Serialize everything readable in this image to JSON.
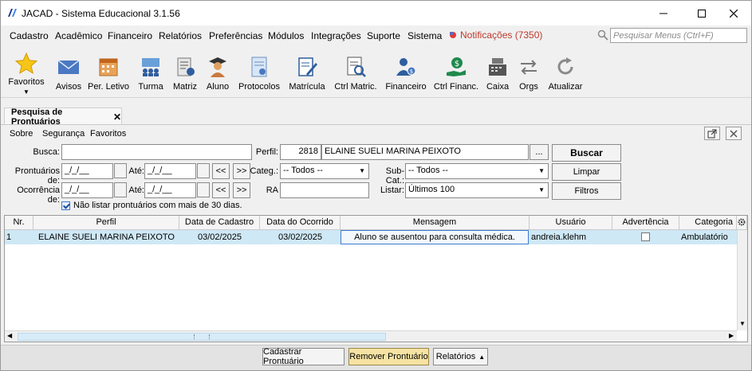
{
  "window": {
    "title": "JACAD - Sistema Educacional 3.1.56"
  },
  "menu": {
    "items": [
      "Cadastro",
      "Acadêmico",
      "Financeiro",
      "Relatórios",
      "Preferências",
      "Módulos",
      "Integrações",
      "Suporte",
      "Sistema"
    ],
    "notifications": "Notificações (7350)",
    "search_placeholder": "Pesquisar Menus (Ctrl+F)"
  },
  "toolbar": {
    "items": [
      "Favoritos",
      "Avisos",
      "Per. Letivo",
      "Turma",
      "Matriz",
      "Aluno",
      "Protocolos",
      "Matrícula",
      "Ctrl Matric.",
      "Financeiro",
      "Ctrl Financ.",
      "Caixa",
      "Orgs",
      "Atualizar"
    ]
  },
  "tab": {
    "label": "Pesquisa de Prontuários"
  },
  "submenu": {
    "items": [
      "Sobre",
      "Segurança",
      "Favoritos"
    ]
  },
  "form": {
    "busca_label": "Busca:",
    "busca_value": "",
    "perfil_label": "Perfil:",
    "perfil_code": "2818",
    "perfil_name": "ELAINE SUELI MARINA PEIXOTO",
    "perfil_btn": "...",
    "prontuarios_label": "Prontuários de:",
    "ocorrencia_label": "Ocorrência de:",
    "ate_label": "Até:",
    "date_empty": "_/_/__",
    "prev_btn": "<<",
    "next_btn": ">>",
    "categ_label": "Categ.:",
    "categ_value": "-- Todos --",
    "subcat_label": "Sub-Cat.:",
    "subcat_value": "-- Todos --",
    "ra_label": "RA",
    "ra_value": "",
    "listar_label": "Listar:",
    "listar_value": "Últimos 100",
    "buscar": "Buscar",
    "limpar": "Limpar",
    "filtros": "Filtros",
    "checkbox_label": "Não listar prontuários com mais de 30 dias.",
    "checkbox_checked": true
  },
  "grid": {
    "headers": [
      "Nr.",
      "Perfil",
      "Data de Cadastro",
      "Data do Ocorrido",
      "Mensagem",
      "Usuário",
      "Advertência",
      "Categoria"
    ],
    "rows": [
      {
        "nr": "1",
        "perfil": "ELAINE SUELI MARINA PEIXOTO",
        "data_cadastro": "03/02/2025",
        "data_ocorrido": "03/02/2025",
        "mensagem": "Aluno se ausentou para consulta médica.",
        "usuario": "andreia.klehm",
        "advertencia": false,
        "categoria": "Ambulatório"
      }
    ]
  },
  "bottom": {
    "cadastrar": "Cadastrar Prontuário",
    "remover": "Remover Prontuário",
    "relatorios": "Relatórios"
  }
}
